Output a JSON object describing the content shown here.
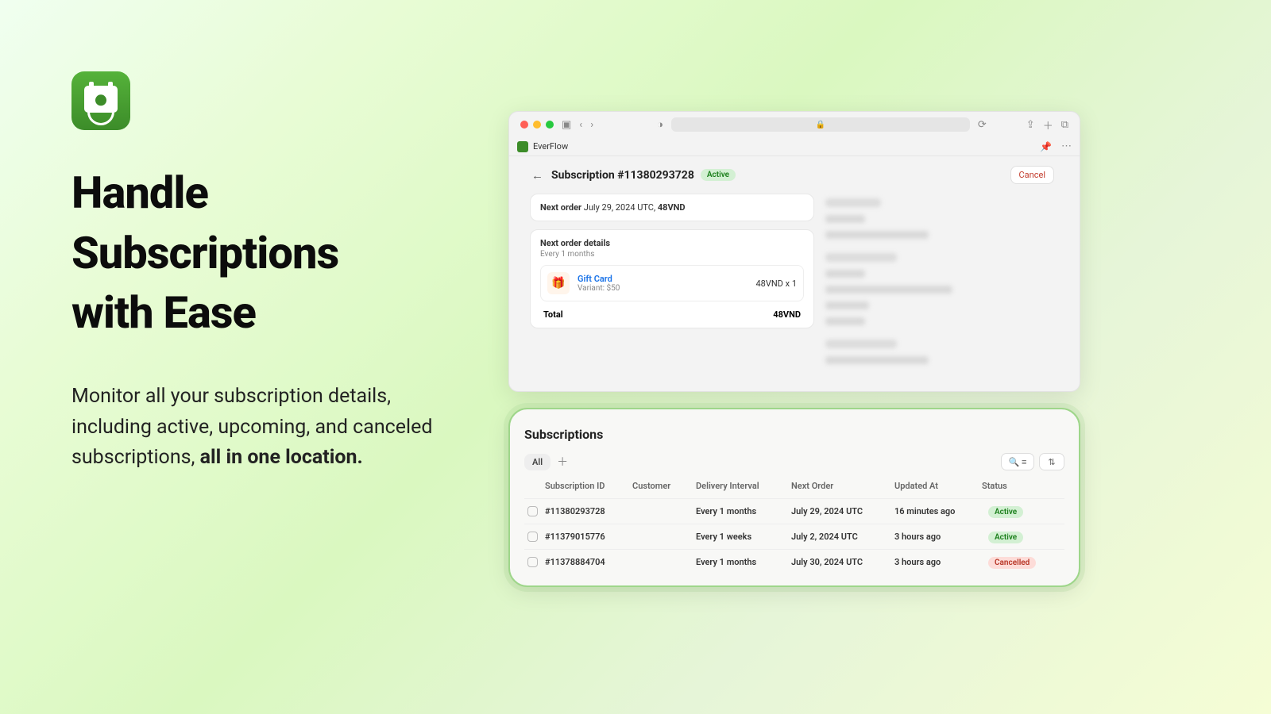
{
  "left": {
    "headline_l1": "Handle",
    "headline_l2": "Subscriptions",
    "headline_l3": "with Ease",
    "sub_prefix": "Monitor all your subscription details, including active, upcoming, and canceled subscriptions, ",
    "sub_bold": "all in one location."
  },
  "browser": {
    "tab_name": "EverFlow"
  },
  "detail": {
    "title": "Subscription #11380293728",
    "status": "Active",
    "cancel_btn": "Cancel",
    "next_order_label": "Next order",
    "next_order_date": "July 29, 2024 UTC,",
    "next_order_amount": "48VND",
    "details_title": "Next order details",
    "interval": "Every 1 months",
    "product_name": "Gift Card",
    "product_variant": "Variant: $50",
    "product_price": "48VND x 1",
    "total_label": "Total",
    "total_amount": "48VND"
  },
  "list": {
    "title": "Subscriptions",
    "tab_all": "All",
    "headers": {
      "id": "Subscription ID",
      "customer": "Customer",
      "interval": "Delivery Interval",
      "next": "Next Order",
      "updated": "Updated At",
      "status": "Status"
    },
    "rows": [
      {
        "id": "#11380293728",
        "interval": "Every 1 months",
        "next": "July 29, 2024 UTC",
        "updated": "16 minutes ago",
        "status": "Active",
        "sclass": "badge-active"
      },
      {
        "id": "#11379015776",
        "interval": "Every 1 weeks",
        "next": "July 2, 2024 UTC",
        "updated": "3 hours ago",
        "status": "Active",
        "sclass": "badge-active"
      },
      {
        "id": "#11378884704",
        "interval": "Every 1 months",
        "next": "July 30, 2024 UTC",
        "updated": "3 hours ago",
        "status": "Cancelled",
        "sclass": "badge-cancel"
      }
    ]
  }
}
